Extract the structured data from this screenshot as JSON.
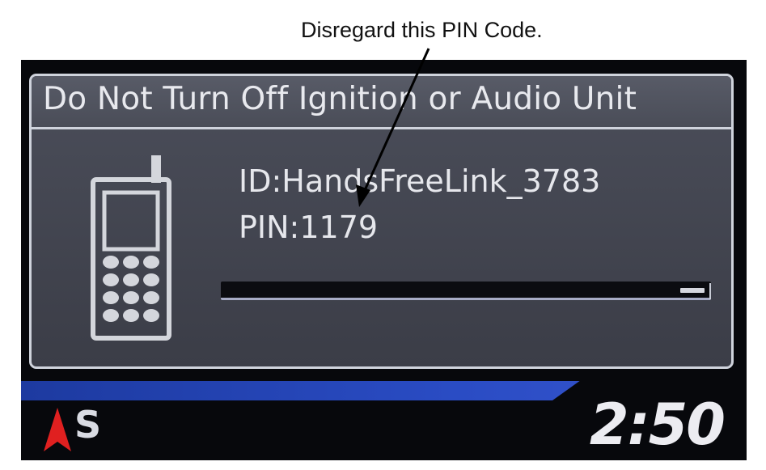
{
  "annotation": {
    "text": "Disregard this PIN Code."
  },
  "dialog": {
    "title": "Do Not Turn Off Ignition or Audio Unit",
    "device_id": "ID:HandsFreeLink_3783",
    "pin": "PIN:1179",
    "progress_fraction": 0.05,
    "icon": "mobile-phone-icon"
  },
  "status_bar": {
    "compass_icon": "north-arrow-icon",
    "compass_direction": "S",
    "clock": "2:50"
  },
  "colors": {
    "panel_bg": "#43464f",
    "panel_border": "#cfd3dc",
    "band_blue": "#2a4cc4",
    "compass_red": "#e02020",
    "text": "#e8e9ee"
  }
}
